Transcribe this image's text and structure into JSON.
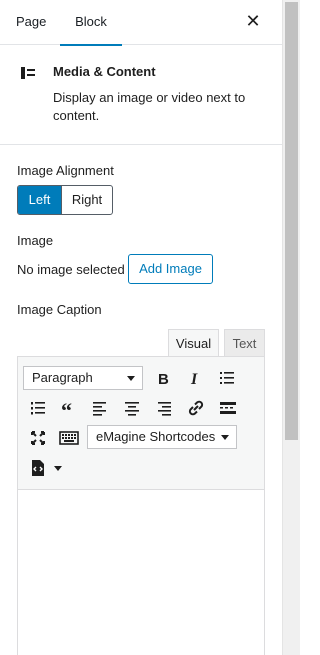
{
  "header": {
    "tabs": [
      {
        "label": "Page"
      },
      {
        "label": "Block"
      }
    ],
    "close_symbol": "✕"
  },
  "block": {
    "icon": "media-text-icon",
    "title": "Media & Content",
    "description": "Display an image or video next to content."
  },
  "alignment": {
    "label": "Image Alignment",
    "options": [
      "Left",
      "Right"
    ],
    "selected": "Left"
  },
  "image": {
    "label": "Image",
    "status": "No image selected",
    "button": "Add Image"
  },
  "caption": {
    "label": "Image Caption",
    "tabs": [
      "Visual",
      "Text"
    ],
    "active_tab": "Visual",
    "format_select": "Paragraph",
    "shortcodes_select": "eMagine Shortcodes",
    "toolbar_icons": [
      "bold-icon",
      "italic-icon",
      "bulleted-list-icon",
      "numbered-list-icon",
      "blockquote-icon",
      "align-left-icon",
      "align-center-icon",
      "align-right-icon",
      "link-icon",
      "read-more-icon",
      "fullscreen-icon",
      "toolbar-toggle-icon",
      "shortcode-icon"
    ]
  },
  "colors": {
    "accent": "#007cba",
    "border": "#e2e4e7",
    "toolbar_bg": "#f6f7f7"
  }
}
